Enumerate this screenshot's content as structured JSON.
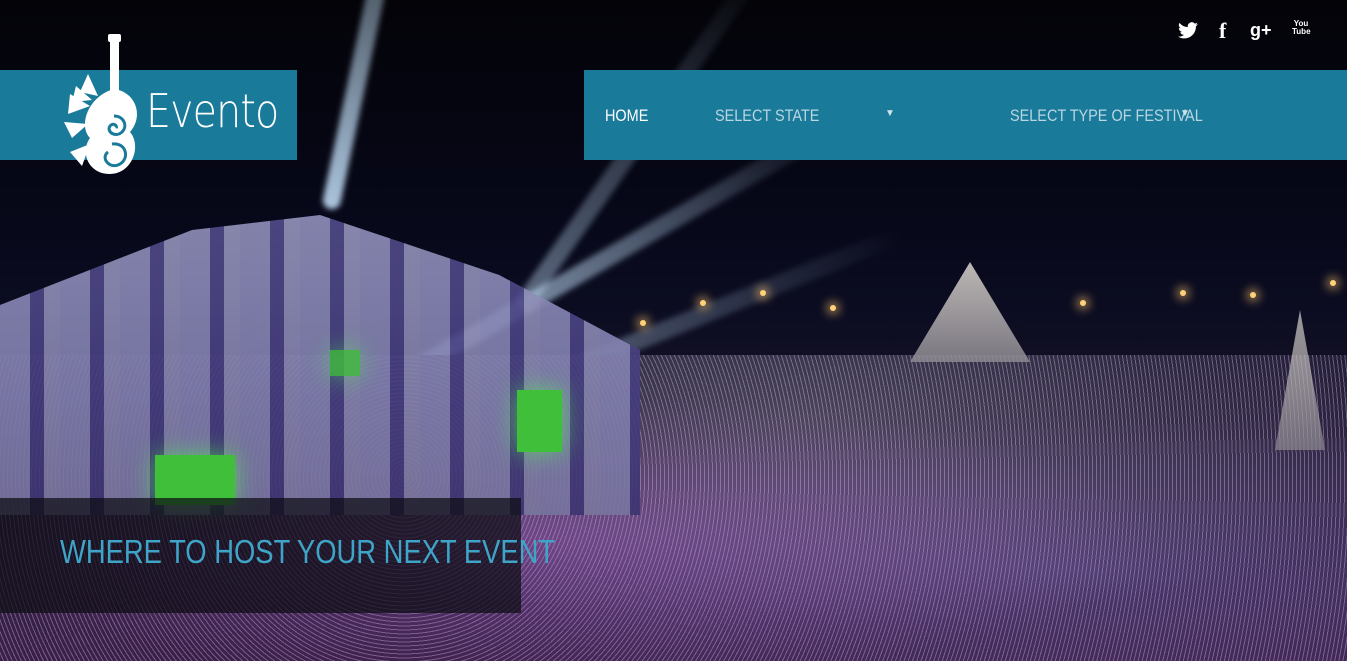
{
  "brand": {
    "name": "Evento",
    "color": "#1a7a9a"
  },
  "social": [
    {
      "name": "twitter",
      "icon": "twitter-icon"
    },
    {
      "name": "facebook",
      "icon": "facebook-icon",
      "glyph": "f"
    },
    {
      "name": "google-plus",
      "icon": "google-plus-icon",
      "glyph": "g+"
    },
    {
      "name": "youtube",
      "icon": "youtube-icon",
      "glyph": "You Tube"
    }
  ],
  "nav": {
    "home": "HOME",
    "select_state": "SELECT STATE",
    "select_festival": "SELECT TYPE OF FESTIVAL",
    "caret": "▼"
  },
  "hero": {
    "caption": "WHERE TO HOST YOUR NEXT EVENT",
    "caption_color": "#3fa5c8"
  }
}
